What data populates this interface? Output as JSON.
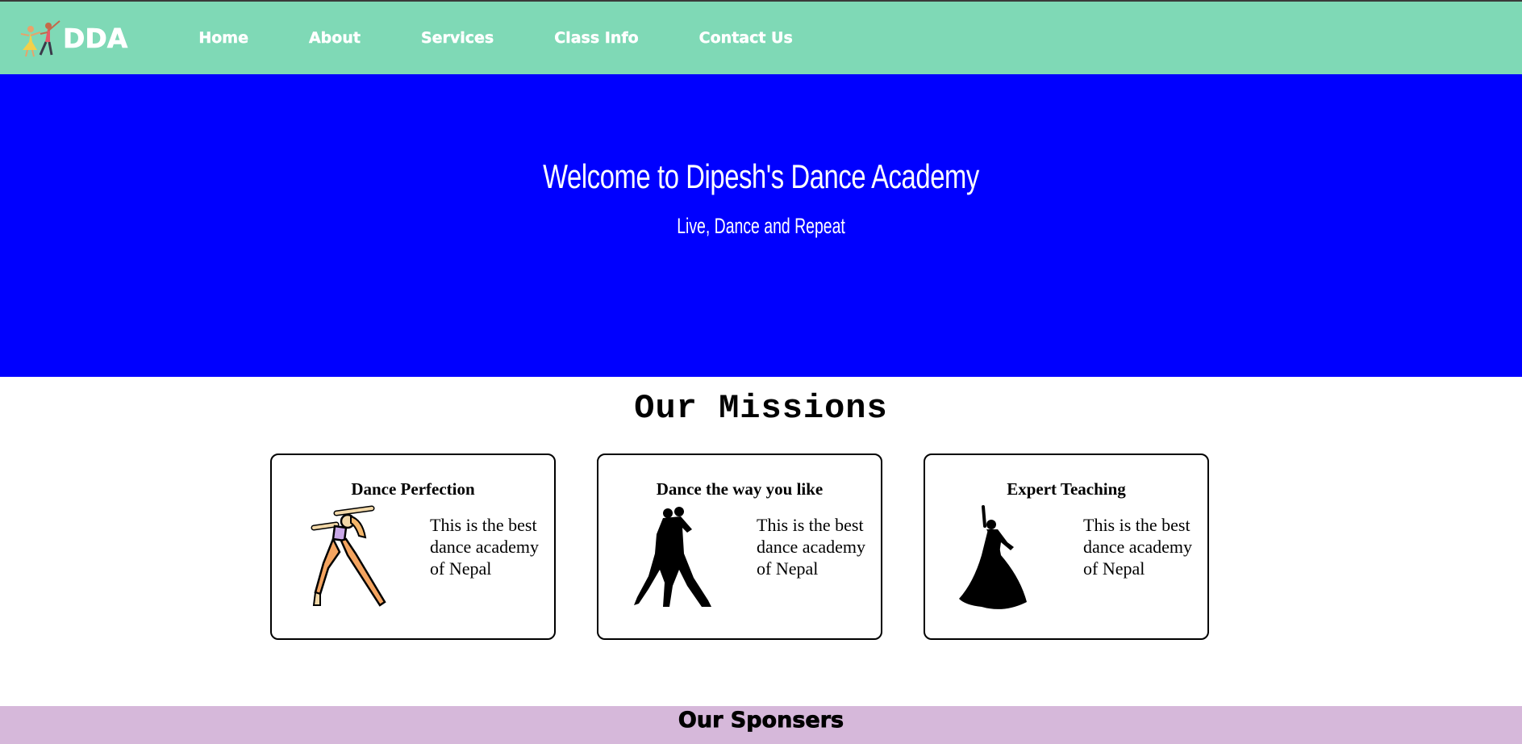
{
  "nav": {
    "brand": "DDA",
    "logo_icon": "dancing-couple-logo",
    "links": [
      {
        "label": "Home"
      },
      {
        "label": "About"
      },
      {
        "label": "Services"
      },
      {
        "label": "Class Info"
      },
      {
        "label": "Contact Us"
      }
    ],
    "background": "#7fd9b6"
  },
  "hero": {
    "title": "Welcome to Dipesh's Dance Academy",
    "subtitle": "Live, Dance and Repeat",
    "background": "#0000ff"
  },
  "missions": {
    "heading": "Our Missions",
    "cards": [
      {
        "title": "Dance Perfection",
        "text": "This is the best dance academy of Nepal",
        "icon": "solo-dancer-icon"
      },
      {
        "title": "Dance the way you like",
        "text": "This is the best dance academy of Nepal",
        "icon": "tango-couple-icon"
      },
      {
        "title": "Expert Teaching",
        "text": "This is the best dance academy of Nepal",
        "icon": "flamenco-dancer-icon"
      }
    ]
  },
  "sponsors": {
    "heading": "Our Sponsers",
    "background": "#d6b8da"
  }
}
